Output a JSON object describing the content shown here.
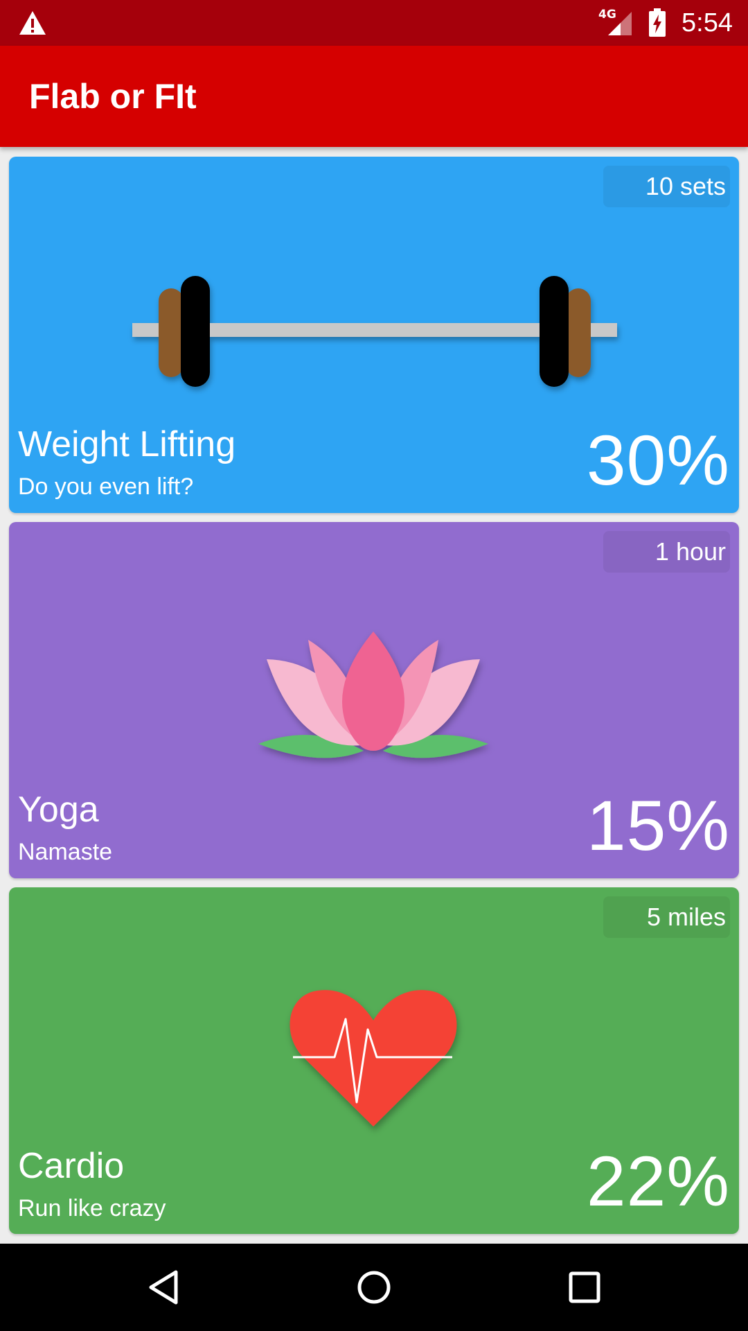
{
  "status_bar": {
    "network_label": "4G",
    "time": "5:54",
    "icons": [
      "warning-icon",
      "signal-icon",
      "battery-charging-icon"
    ]
  },
  "app_bar": {
    "title": "Flab or FIt",
    "color": "#d50000"
  },
  "cards": [
    {
      "badge": "10 sets",
      "name": "Weight Lifting",
      "subtitle": "Do you even lift?",
      "percent": "30%",
      "color": "#2ea4f3",
      "icon": "barbell-icon"
    },
    {
      "badge": "1 hour",
      "name": "Yoga",
      "subtitle": "Namaste",
      "percent": "15%",
      "color": "#916ccf",
      "icon": "lotus-icon"
    },
    {
      "badge": "5 miles",
      "name": "Cardio",
      "subtitle": "Run like crazy",
      "percent": "22%",
      "color": "#55ad56",
      "icon": "heartbeat-icon"
    }
  ],
  "nav_bar": {
    "icons": [
      "back-icon",
      "home-icon",
      "recents-icon"
    ]
  }
}
